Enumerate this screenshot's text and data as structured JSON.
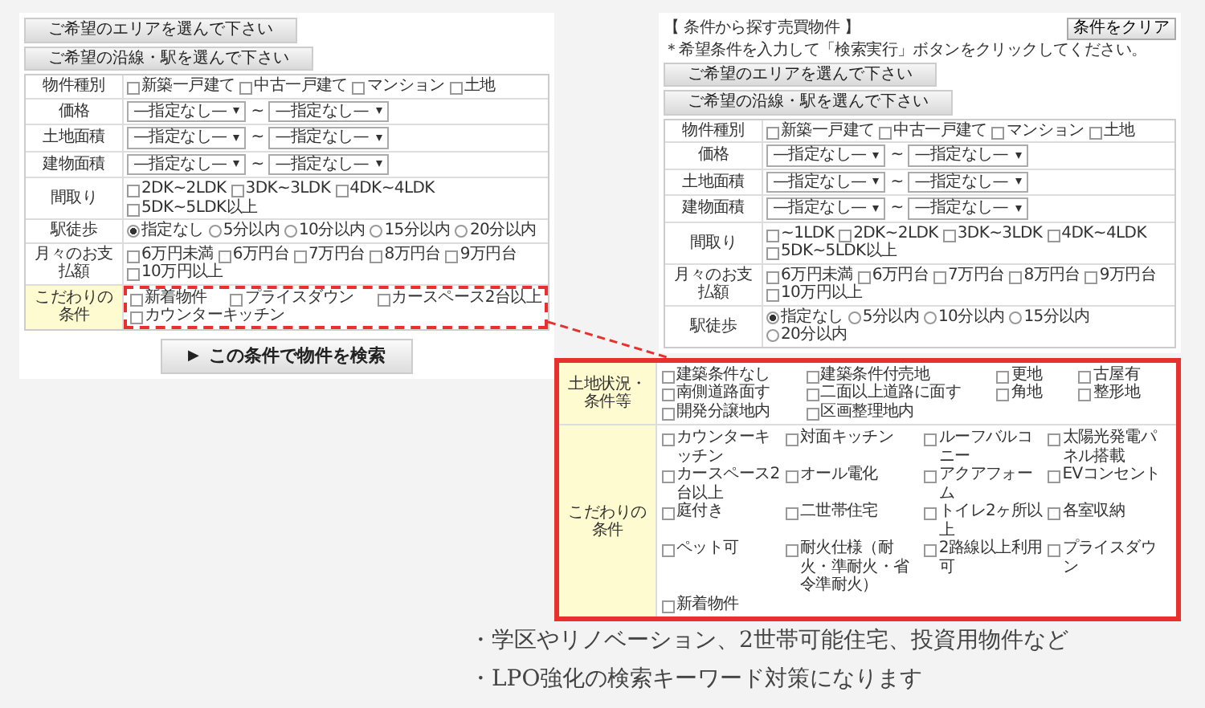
{
  "left_screen": {
    "area_button": "ご希望のエリアを選んで下さい",
    "line_button": "ご希望の沿線・駅を選んで下さい",
    "rows": [
      {
        "label": "物件種別",
        "kind": "checkbox",
        "highlighted": false,
        "options": [
          {
            "label": "新築一戸建て",
            "checked": false
          },
          {
            "label": "中古一戸建て",
            "checked": false
          },
          {
            "label": "マンション",
            "checked": false
          },
          {
            "label": "土地",
            "checked": false
          }
        ]
      },
      {
        "label": "価格",
        "kind": "range",
        "highlighted": false,
        "from": "—指定なし—",
        "separator": "~",
        "to": "—指定なし—"
      },
      {
        "label": "土地面積",
        "kind": "range",
        "highlighted": false,
        "from": "—指定なし—",
        "separator": "~",
        "to": "—指定なし—"
      },
      {
        "label": "建物面積",
        "kind": "range",
        "highlighted": false,
        "from": "—指定なし—",
        "separator": "~",
        "to": "—指定なし—"
      },
      {
        "label": "間取り",
        "kind": "checkbox",
        "highlighted": false,
        "options": [
          {
            "label": "2DK~2LDK",
            "checked": false
          },
          {
            "label": "3DK~3LDK",
            "checked": false
          },
          {
            "label": "4DK~4LDK",
            "checked": false
          },
          {
            "label": "5DK~5LDK以上",
            "checked": false
          }
        ]
      },
      {
        "label": "駅徒歩",
        "kind": "radio",
        "highlighted": false,
        "options": [
          {
            "label": "指定なし",
            "selected": true
          },
          {
            "label": "5分以内",
            "selected": false
          },
          {
            "label": "10分以内",
            "selected": false
          },
          {
            "label": "15分以内",
            "selected": false
          },
          {
            "label": "20分以内",
            "selected": false
          }
        ]
      },
      {
        "label": "月々のお支払額",
        "kind": "checkbox",
        "highlighted": false,
        "options": [
          {
            "label": "6万円未満",
            "checked": false
          },
          {
            "label": "6万円台",
            "checked": false
          },
          {
            "label": "7万円台",
            "checked": false
          },
          {
            "label": "8万円台",
            "checked": false
          },
          {
            "label": "9万円台",
            "checked": false
          },
          {
            "label": "10万円以上",
            "checked": false
          }
        ]
      },
      {
        "label": "こだわりの条件",
        "kind": "checkbox",
        "highlighted": true,
        "options": [
          {
            "label": "新着物件",
            "checked": false
          },
          {
            "label": "プライスダウン",
            "checked": false
          },
          {
            "label": "カースペース2台以上",
            "checked": false
          },
          {
            "label": "カウンターキッチン",
            "checked": false
          }
        ]
      }
    ],
    "search_button": {
      "icon": "▶",
      "label": "この条件で物件を検索"
    }
  },
  "right_screen": {
    "header_title": "【 条件から探す売買物件 】",
    "note": "＊希望条件を入力して「検索実行」ボタンをクリックしてください。",
    "clear_button": "条件をクリア",
    "area_button": "ご希望のエリアを選んで下さい",
    "line_button": "ご希望の沿線・駅を選んで下さい",
    "rows": [
      {
        "label": "物件種別",
        "kind": "checkbox",
        "highlighted": false,
        "options": [
          {
            "label": "新築一戸建て",
            "checked": false
          },
          {
            "label": "中古一戸建て",
            "checked": false
          },
          {
            "label": "マンション",
            "checked": false
          },
          {
            "label": "土地",
            "checked": false
          }
        ]
      },
      {
        "label": "価格",
        "kind": "range",
        "highlighted": false,
        "from": "—指定なし—",
        "separator": "~",
        "to": "—指定なし—"
      },
      {
        "label": "土地面積",
        "kind": "range",
        "highlighted": false,
        "from": "—指定なし—",
        "separator": "~",
        "to": "—指定なし—"
      },
      {
        "label": "建物面積",
        "kind": "range",
        "highlighted": false,
        "from": "—指定なし—",
        "separator": "~",
        "to": "—指定なし—"
      },
      {
        "label": "間取り",
        "kind": "checkbox",
        "highlighted": false,
        "options": [
          {
            "label": "~1LDK",
            "checked": false
          },
          {
            "label": "2DK~2LDK",
            "checked": false
          },
          {
            "label": "3DK~3LDK",
            "checked": false
          },
          {
            "label": "4DK~4LDK",
            "checked": false
          },
          {
            "label": "5DK~5LDK以上",
            "checked": false
          }
        ]
      },
      {
        "label": "月々のお支払額",
        "kind": "checkbox",
        "highlighted": false,
        "options": [
          {
            "label": "6万円未満",
            "checked": false
          },
          {
            "label": "6万円台",
            "checked": false
          },
          {
            "label": "7万円台",
            "checked": false
          },
          {
            "label": "8万円台",
            "checked": false
          },
          {
            "label": "9万円台",
            "checked": false
          },
          {
            "label": "10万円以上",
            "checked": false
          }
        ]
      },
      {
        "label": "駅徒歩",
        "kind": "radio",
        "highlighted": false,
        "options": [
          {
            "label": "指定なし",
            "selected": true
          },
          {
            "label": "5分以内",
            "selected": false
          },
          {
            "label": "10分以内",
            "selected": false
          },
          {
            "label": "15分以内",
            "selected": false
          },
          {
            "label": "20分以内",
            "selected": false
          }
        ]
      }
    ]
  },
  "callout": {
    "rows": [
      {
        "label": "土地状況・条件等",
        "kind": "checkbox",
        "options": [
          {
            "label": "建築条件なし",
            "checked": false
          },
          {
            "label": "建築条件付売地",
            "checked": false
          },
          {
            "label": "更地",
            "checked": false
          },
          {
            "label": "古屋有",
            "checked": false
          },
          {
            "label": "南側道路面す",
            "checked": false
          },
          {
            "label": "二面以上道路に面す",
            "checked": false
          },
          {
            "label": "角地",
            "checked": false
          },
          {
            "label": "整形地",
            "checked": false
          },
          {
            "label": "開発分譲地内",
            "checked": false
          },
          {
            "label": "区画整理地内",
            "checked": false
          }
        ]
      },
      {
        "label": "こだわりの条件",
        "kind": "checkbox",
        "options": [
          {
            "label": "カウンターキッチン",
            "checked": false
          },
          {
            "label": "対面キッチン",
            "checked": false
          },
          {
            "label": "ルーフバルコニー",
            "checked": false
          },
          {
            "label": "太陽光発電パネル搭載",
            "checked": false
          },
          {
            "label": "カースペース2台以上",
            "checked": false
          },
          {
            "label": "オール電化",
            "checked": false
          },
          {
            "label": "アクアフォーム",
            "checked": false
          },
          {
            "label": "EVコンセント",
            "checked": false
          },
          {
            "label": "庭付き",
            "checked": false
          },
          {
            "label": "二世帯住宅",
            "checked": false
          },
          {
            "label": "トイレ2ヶ所以上",
            "checked": false
          },
          {
            "label": "各室収納",
            "checked": false
          },
          {
            "label": "ペット可",
            "checked": false
          },
          {
            "label": "耐火仕様（耐火・準耐火・省令準耐火）",
            "checked": false
          },
          {
            "label": "2路線以上利用可",
            "checked": false
          },
          {
            "label": "プライスダウン",
            "checked": false
          },
          {
            "label": "新着物件",
            "checked": false
          }
        ]
      }
    ]
  },
  "bullets": [
    "・学区やリノベーション、2世帯可能住宅、投資用物件など",
    "・LPO強化の検索キーワード対策になります"
  ]
}
